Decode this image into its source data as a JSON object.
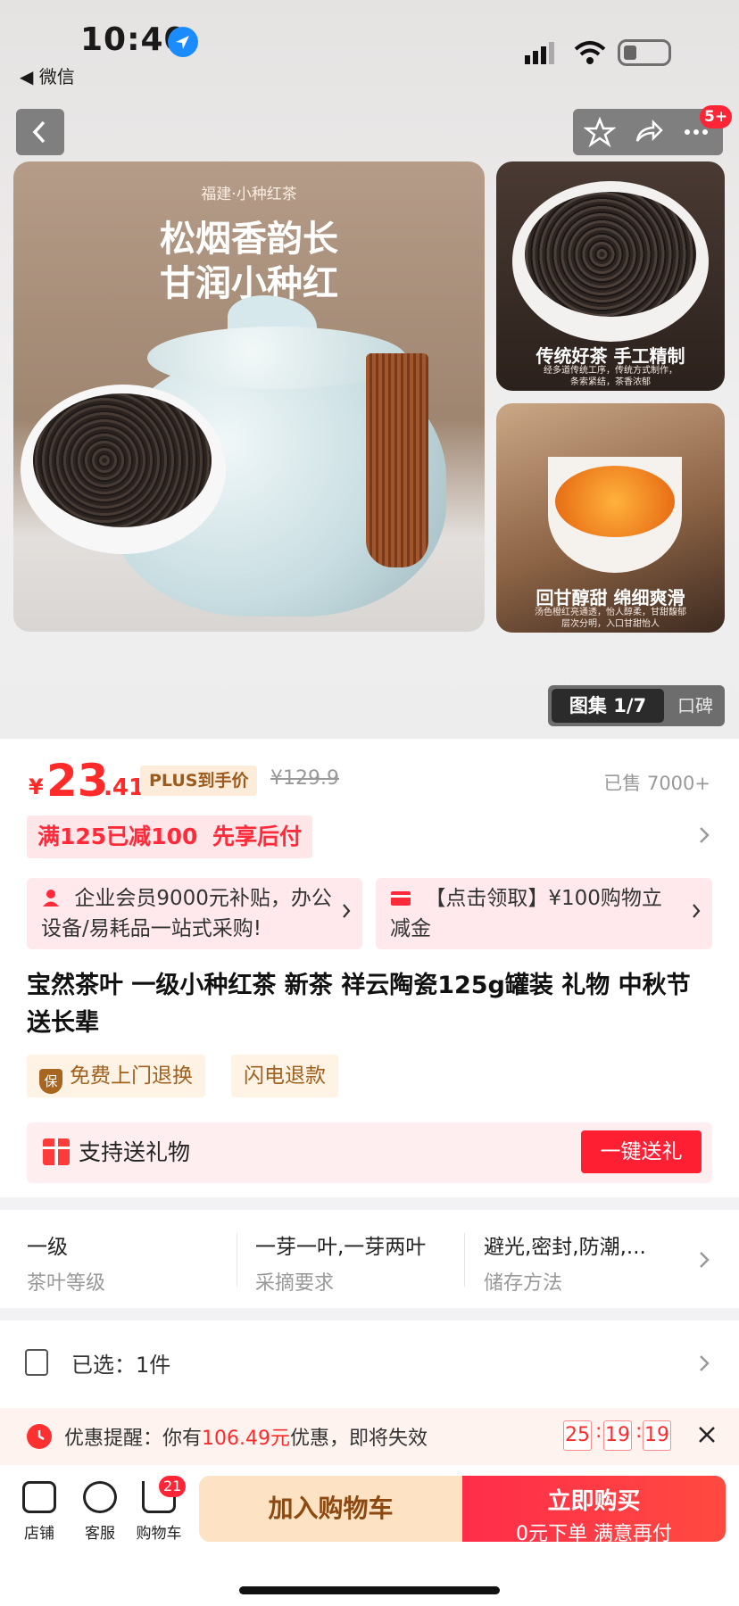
{
  "status_bar": {
    "time": "10:40",
    "back_app": "◀ 微信"
  },
  "nav": {
    "back_icon": "chevron-left-icon",
    "notification_count": "5+"
  },
  "gallery": {
    "main": {
      "subtitle": "福建·小种红茶",
      "line1": "松烟香韵长",
      "line2": "甘润小种红"
    },
    "side1": {
      "caption": "传统好茶 手工精制",
      "small1": "经多道传统工序，传统方式制作，",
      "small2": "条索紧结，茶香浓郁"
    },
    "side2": {
      "caption": "回甘醇甜 绵细爽滑",
      "small1": "汤色橙红亮通透，怡人醇柔，甘甜馥郁",
      "small2": "层次分明，入口甘甜怡人"
    },
    "tab_active": "图集 1/7",
    "tab_other": "口碑"
  },
  "price": {
    "yen": "¥",
    "integer": "23",
    "decimal": ".41",
    "plus_tag": "PLUS到手价",
    "original": "¥129.9",
    "sold": "已售 7000+"
  },
  "promos": [
    "满125已减100",
    "先享后付"
  ],
  "banners": [
    {
      "icon": "person-icon",
      "text": "企业会员9000元补贴，办公设备/易耗品一站式采购!"
    },
    {
      "icon": "card-icon",
      "text": "【点击领取】¥100购物立减金"
    }
  ],
  "title": "宝然茶叶 一级小种红茶  新茶 祥云陶瓷125g罐装 礼物 中秋节送长辈",
  "services": {
    "shield": "保",
    "free_return": "免费上门退换",
    "fast_refund": "闪电退款"
  },
  "gift": {
    "label": "支持送礼物",
    "button": "一键送礼"
  },
  "specs": [
    {
      "value": "一级",
      "key": "茶叶等级"
    },
    {
      "value": "一芽一叶,一芽两叶",
      "key": "采摘要求"
    },
    {
      "value": "避光,密封,防潮,...",
      "key": "储存方法"
    }
  ],
  "selected": {
    "text": "已选：1件"
  },
  "reminder": {
    "prefix": "优惠提醒：你有",
    "amount": "106.49元",
    "suffix": "优惠，即将失效",
    "h": "25",
    "m": "19",
    "s": "19",
    "sep": ":"
  },
  "bottom": {
    "store": "店铺",
    "service": "客服",
    "cart": "购物车",
    "cart_count": "21",
    "add_cart": "加入购物车",
    "buy_now": "立即购买",
    "buy_sub": "0元下单 满意再付"
  },
  "colors": {
    "accent": "#ff2a3a",
    "plus": "#9c5a1c"
  }
}
